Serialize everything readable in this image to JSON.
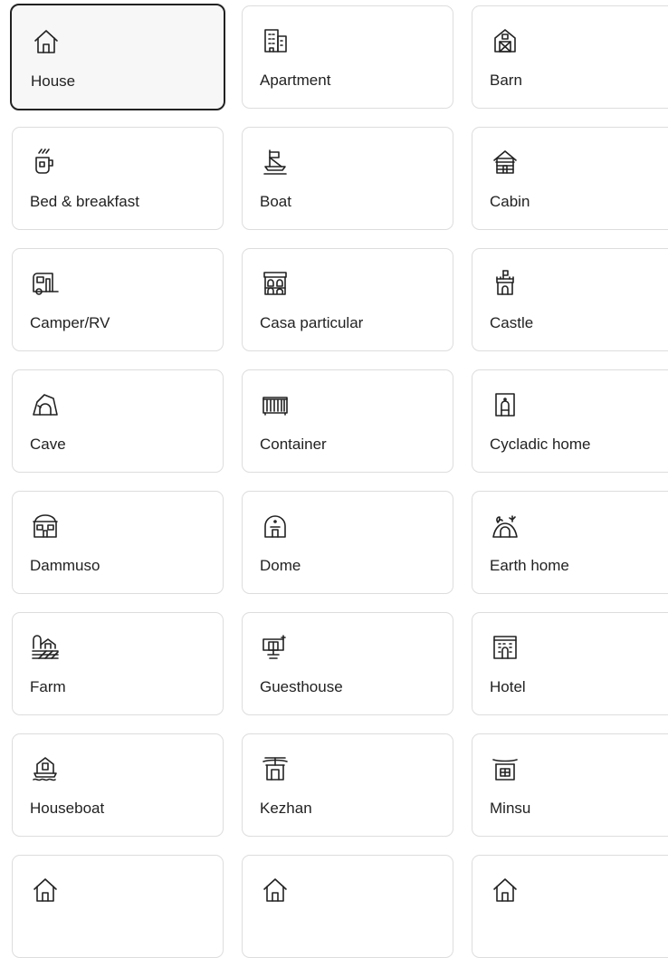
{
  "property_types": [
    {
      "label": "House",
      "icon": "house-icon",
      "selected": true
    },
    {
      "label": "Apartment",
      "icon": "apartment-icon"
    },
    {
      "label": "Barn",
      "icon": "barn-icon"
    },
    {
      "label": "Bed & breakfast",
      "icon": "bed-and-breakfast-icon"
    },
    {
      "label": "Boat",
      "icon": "boat-icon"
    },
    {
      "label": "Cabin",
      "icon": "cabin-icon"
    },
    {
      "label": "Camper/RV",
      "icon": "camper-icon"
    },
    {
      "label": "Casa particular",
      "icon": "casa-particular-icon"
    },
    {
      "label": "Castle",
      "icon": "castle-icon"
    },
    {
      "label": "Cave",
      "icon": "cave-icon"
    },
    {
      "label": "Container",
      "icon": "container-icon"
    },
    {
      "label": "Cycladic home",
      "icon": "cycladic-home-icon"
    },
    {
      "label": "Dammuso",
      "icon": "dammuso-icon"
    },
    {
      "label": "Dome",
      "icon": "dome-icon"
    },
    {
      "label": "Earth home",
      "icon": "earth-home-icon"
    },
    {
      "label": "Farm",
      "icon": "farm-icon"
    },
    {
      "label": "Guesthouse",
      "icon": "guesthouse-icon"
    },
    {
      "label": "Hotel",
      "icon": "hotel-icon"
    },
    {
      "label": "Houseboat",
      "icon": "houseboat-icon"
    },
    {
      "label": "Kezhan",
      "icon": "kezhan-icon"
    },
    {
      "label": "Minsu",
      "icon": "minsu-icon"
    },
    {
      "label": "",
      "icon": "house-icon"
    },
    {
      "label": "",
      "icon": "house-icon"
    },
    {
      "label": "",
      "icon": "house-icon"
    }
  ],
  "colors": {
    "text": "#222222",
    "border": "#dddddd",
    "selected_border": "#222222",
    "selected_bg": "#f7f7f7"
  }
}
